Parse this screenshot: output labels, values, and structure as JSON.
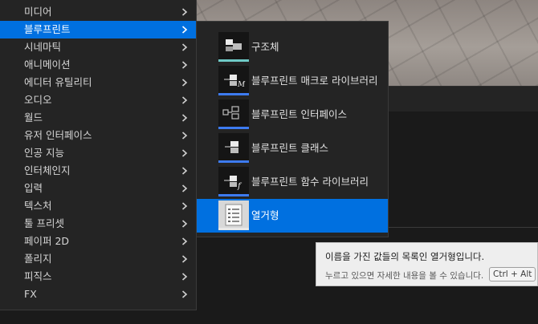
{
  "category_menu": {
    "items": [
      {
        "label": "미디어",
        "selected": false
      },
      {
        "label": "블루프린트",
        "selected": true
      },
      {
        "label": "시네마틱",
        "selected": false
      },
      {
        "label": "애니메이션",
        "selected": false
      },
      {
        "label": "에디터 유틸리티",
        "selected": false
      },
      {
        "label": "오디오",
        "selected": false
      },
      {
        "label": "월드",
        "selected": false
      },
      {
        "label": "유저 인터페이스",
        "selected": false
      },
      {
        "label": "인공 지능",
        "selected": false
      },
      {
        "label": "인터체인지",
        "selected": false
      },
      {
        "label": "입력",
        "selected": false
      },
      {
        "label": "텍스처",
        "selected": false
      },
      {
        "label": "툴 프리셋",
        "selected": false
      },
      {
        "label": "페이퍼 2D",
        "selected": false
      },
      {
        "label": "폴리지",
        "selected": false
      },
      {
        "label": "피직스",
        "selected": false
      },
      {
        "label": "FX",
        "selected": false
      }
    ],
    "chevron_icon": "chevron-right-icon"
  },
  "sub_menu": {
    "items": [
      {
        "label": "구조체",
        "icon": "struct-icon",
        "accent": "#6fcac6",
        "selected": false
      },
      {
        "label": "블루프린트 매크로 라이브러리",
        "icon": "macro-library-icon",
        "accent": "#3d7bf0",
        "selected": false
      },
      {
        "label": "블루프린트 인터페이스",
        "icon": "interface-icon",
        "accent": "#3d7bf0",
        "selected": false
      },
      {
        "label": "블루프린트 클래스",
        "icon": "class-icon",
        "accent": "#3d7bf0",
        "selected": false
      },
      {
        "label": "블루프린트 함수 라이브러리",
        "icon": "function-library-icon",
        "accent": "#3d7bf0",
        "selected": false
      },
      {
        "label": "열거형",
        "icon": "enum-icon",
        "accent": "#e8e8e8",
        "selected": true
      }
    ]
  },
  "tooltip": {
    "description": "이름을 가진 값들의 목록인 열거형입니다.",
    "hint": "누르고 있으면 자세한 내용을 볼 수 있습니다.",
    "shortcut": "Ctrl + Alt"
  },
  "colors": {
    "selection": "#0070e0",
    "menu_background": "#242424",
    "tooltip_background": "#eeeeee"
  }
}
